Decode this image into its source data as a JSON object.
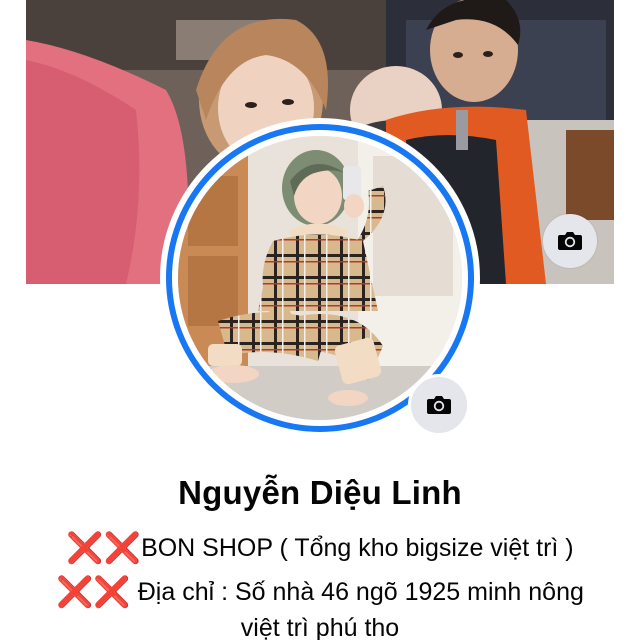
{
  "profile": {
    "name": "Nguyễn Diệu Linh",
    "bio": {
      "line1_marker": "❌❌",
      "line1_text": "BON SHOP ( Tổng kho bigsize việt trì )",
      "line2_marker": "❌❌",
      "line2_text": " Địa chỉ : Số nhà 46 ngõ 1925 minh nông",
      "line3_text": "việt trì phú tho"
    }
  },
  "icons": {
    "cover_camera": "camera-icon",
    "avatar_camera": "camera-icon"
  },
  "colors": {
    "avatar_ring": "#1877f2",
    "camera_button_bg": "#e4e6eb",
    "marker_red": "#e0241b",
    "text": "#050505"
  }
}
